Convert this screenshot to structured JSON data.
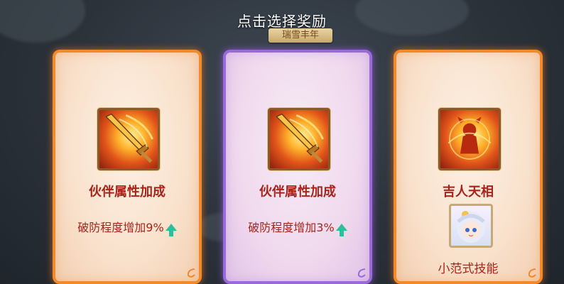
{
  "header": {
    "title": "点击选择奖励",
    "banner": "瑞雪丰年"
  },
  "cards": [
    {
      "frame": "orange",
      "icon": "flaming-sword-icon",
      "name": "伙伴属性加成",
      "bonus": "破防程度增加9%"
    },
    {
      "frame": "purple",
      "icon": "flaming-sword-icon",
      "name": "伙伴属性加成",
      "bonus": "破防程度增加3%"
    },
    {
      "frame": "orange",
      "icon": "fire-warrior-icon",
      "name": "吉人天相",
      "portrait": "character-portrait",
      "skill": "小范式技能"
    }
  ],
  "colors": {
    "orange_frame": "#f08a2c",
    "purple_frame": "#9a6bd8",
    "text_red": "#a8241a",
    "arrow_green": "#2dbf9c"
  }
}
